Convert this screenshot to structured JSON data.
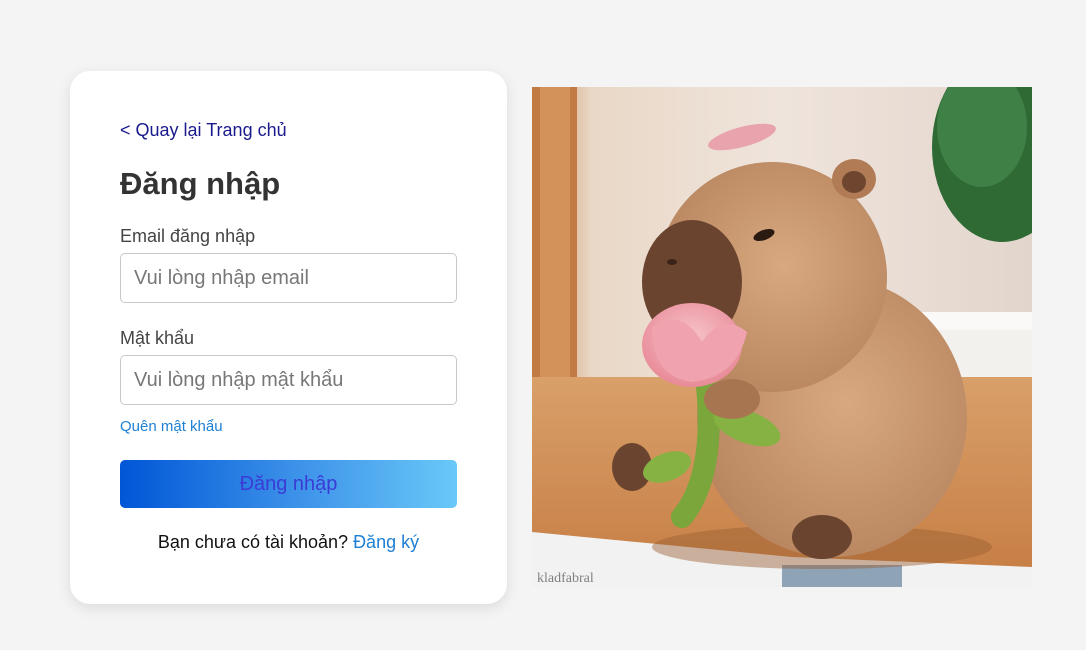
{
  "back_link": "< Quay lại Trang chủ",
  "title": "Đăng nhập",
  "email": {
    "label": "Email đăng nhập",
    "placeholder": "Vui lòng nhập email"
  },
  "password": {
    "label": "Mật khẩu",
    "placeholder": "Vui lòng nhập mật khẩu"
  },
  "forgot_password": "Quên mật khẩu",
  "login_button": "Đăng nhập",
  "signup": {
    "prompt": "Bạn chưa có tài khoản? ",
    "link": "Đăng ký"
  },
  "colors": {
    "background": "#f4f4f4",
    "link_blue": "#1e7fd4",
    "button_gradient_start": "#0056d6",
    "button_gradient_end": "#6ac8f8"
  }
}
